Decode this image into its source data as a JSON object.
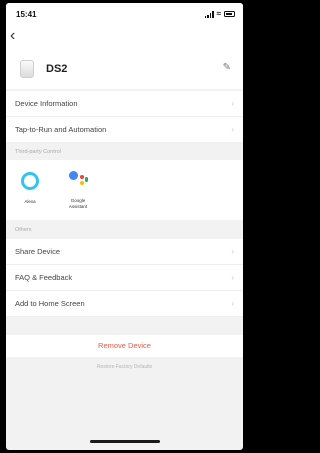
{
  "status_bar": {
    "time": "15:41"
  },
  "header": {
    "back_icon": "chevron-left-icon",
    "device_name": "DS2",
    "edit_icon": "pencil-icon"
  },
  "menu": {
    "device_information": "Device Information",
    "tap_to_run": "Tap-to-Run and Automation"
  },
  "third_party": {
    "section_label": "Third-party Control",
    "items": [
      {
        "label": "Alexa"
      },
      {
        "label_line1": "Google",
        "label_line2": "Assistant"
      }
    ]
  },
  "others": {
    "section_label": "Others",
    "share_device": "Share Device",
    "faq_feedback": "FAQ & Feedback",
    "add_home_screen": "Add to Home Screen"
  },
  "actions": {
    "remove_device": "Remove Device",
    "restore_factory": "Restore Factory Defaults"
  },
  "colors": {
    "accent_red": "#e65a4d",
    "alexa_blue": "#31c4f3",
    "google_blue": "#4285f4",
    "google_red": "#ea4335",
    "google_yellow": "#fbbc05",
    "google_green": "#34a853"
  }
}
